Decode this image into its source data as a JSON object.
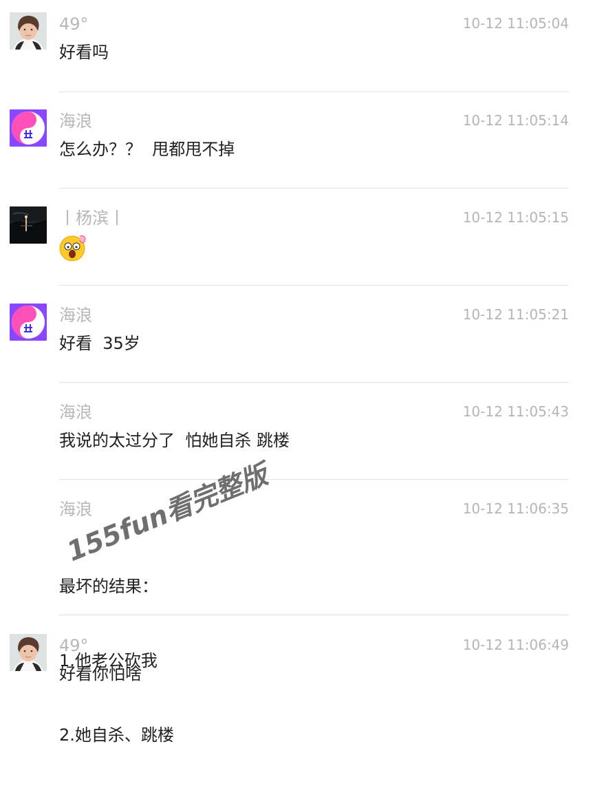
{
  "messages": [
    {
      "sender": "49°",
      "time": "10-12 11:05:04",
      "text": "好看吗",
      "avatar": "person-avatar"
    },
    {
      "sender": "海浪",
      "time": "10-12 11:05:14",
      "text": "怎么办？？  甩都甩不掉",
      "avatar": "logo-avatar"
    },
    {
      "sender": "丨杨滨丨",
      "time": "10-12 11:05:15",
      "text": "",
      "emoji": "surprised-emoji-icon",
      "avatar": "night-scene-avatar"
    },
    {
      "sender": "海浪",
      "time": "10-12 11:05:21",
      "text": "好看  35岁",
      "avatar": "logo-avatar"
    },
    {
      "sender": "海浪",
      "time": "10-12 11:05:43",
      "text": "我说的太过分了  怕她自杀 跳楼",
      "avatar": ""
    },
    {
      "sender": "海浪",
      "time": "10-12 11:06:35",
      "lines": [
        "最坏的结果：",
        "1.他老公砍我",
        "2.她自杀、跳楼"
      ],
      "avatar": ""
    },
    {
      "sender": "49°",
      "time": "10-12 11:06:49",
      "text": "好看你怕啥",
      "avatar": "person-avatar"
    }
  ],
  "watermark": "155fun看完整版",
  "colors": {
    "name": "#b7b7b7",
    "time": "#b5b5b5",
    "text": "#202020",
    "divider": "#e3e3e3",
    "logo_purple": "#8b46ff",
    "logo_pink": "#ff4fb8"
  }
}
